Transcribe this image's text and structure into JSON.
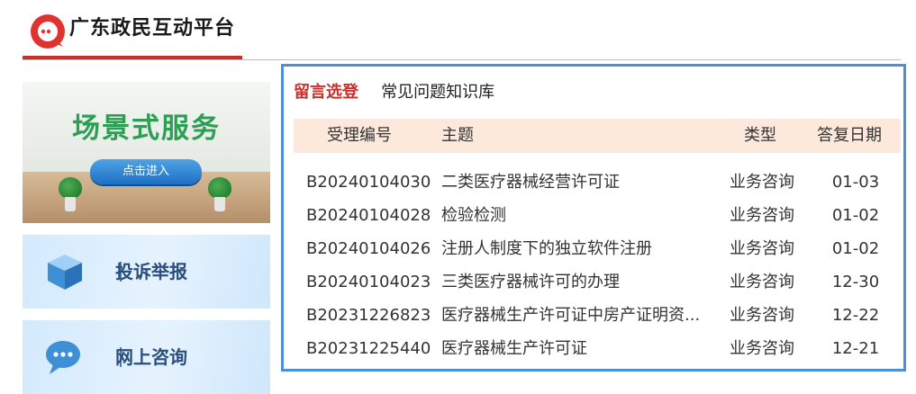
{
  "header": {
    "site_title": "广东政民互动平台",
    "logo_icon": "chat-bubble-logo-icon",
    "accent_color": "#c9302c"
  },
  "sidebar": {
    "banner": {
      "title": "场景式服务",
      "button_label": "点击进入"
    },
    "cards": [
      {
        "label": "投诉举报",
        "icon": "cube-box-icon"
      },
      {
        "label": "网上咨询",
        "icon": "chat-dots-icon"
      }
    ]
  },
  "panel": {
    "border_color": "#4a90d9",
    "tabs": [
      {
        "label": "留言选登",
        "active": true
      },
      {
        "label": "常见问题知识库",
        "active": false
      }
    ],
    "columns": {
      "id": "受理编号",
      "subject": "主题",
      "type": "类型",
      "date": "答复日期"
    },
    "rows": [
      {
        "id": "B20240104030",
        "subject": "二类医疗器械经营许可证",
        "type": "业务咨询",
        "date": "01-03"
      },
      {
        "id": "B20240104028",
        "subject": "检验检测",
        "type": "业务咨询",
        "date": "01-02"
      },
      {
        "id": "B20240104026",
        "subject": "注册人制度下的独立软件注册",
        "type": "业务咨询",
        "date": "01-02"
      },
      {
        "id": "B20240104023",
        "subject": "三类医疗器械许可的办理",
        "type": "业务咨询",
        "date": "12-30"
      },
      {
        "id": "B20231226823",
        "subject": "医疗器械生产许可证中房产证明资...",
        "type": "业务咨询",
        "date": "12-22"
      },
      {
        "id": "B20231225440",
        "subject": "医疗器械生产许可证",
        "type": "业务咨询",
        "date": "12-21"
      }
    ]
  }
}
